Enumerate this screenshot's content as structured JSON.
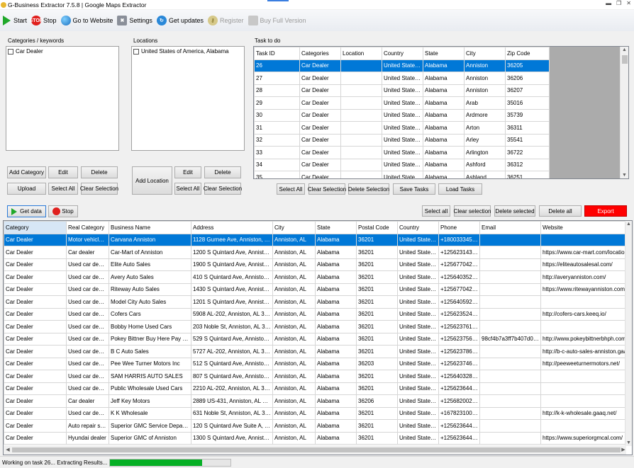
{
  "title": "G-Business Extractor 7.5.8 | Google Maps Extractor",
  "toolbar": {
    "start": "Start",
    "stop": "Stop",
    "website": "Go to Website",
    "settings": "Settings",
    "updates": "Get updates",
    "register": "Register",
    "buy": "Buy Full Version"
  },
  "categories": {
    "label": "Categories / keywords",
    "items": [
      "Car Dealer"
    ],
    "add": "Add Category",
    "edit": "Edit",
    "delete": "Delete",
    "upload": "Upload",
    "select_all": "Select All",
    "clear": "Clear Selection"
  },
  "locations": {
    "label": "Locations",
    "items": [
      "United States of America, Alabama"
    ],
    "add": "Add Location",
    "edit": "Edit",
    "delete": "Delete",
    "select_all": "Select All",
    "clear": "Clear Selection"
  },
  "tasks": {
    "label": "Task to do",
    "columns": [
      "Task ID",
      "Categories",
      "Location",
      "Country",
      "State",
      "City",
      "Zip Code"
    ],
    "rows": [
      [
        "26",
        "Car Dealer",
        "",
        "United States of ...",
        "Alabama",
        "Anniston",
        "36205"
      ],
      [
        "27",
        "Car Dealer",
        "",
        "United States of ...",
        "Alabama",
        "Anniston",
        "36206"
      ],
      [
        "28",
        "Car Dealer",
        "",
        "United States of ...",
        "Alabama",
        "Anniston",
        "36207"
      ],
      [
        "29",
        "Car Dealer",
        "",
        "United States of ...",
        "Alabama",
        "Arab",
        "35016"
      ],
      [
        "30",
        "Car Dealer",
        "",
        "United States of ...",
        "Alabama",
        "Ardmore",
        "35739"
      ],
      [
        "31",
        "Car Dealer",
        "",
        "United States of ...",
        "Alabama",
        "Arton",
        "36311"
      ],
      [
        "32",
        "Car Dealer",
        "",
        "United States of ...",
        "Alabama",
        "Arley",
        "35541"
      ],
      [
        "33",
        "Car Dealer",
        "",
        "United States of ...",
        "Alabama",
        "Arlington",
        "36722"
      ],
      [
        "34",
        "Car Dealer",
        "",
        "United States of ...",
        "Alabama",
        "Ashford",
        "36312"
      ],
      [
        "35",
        "Car Dealer",
        "",
        "United States of ...",
        "Alabama",
        "Ashland",
        "36251"
      ]
    ],
    "select_all": "Select All",
    "clear": "Clear Selection",
    "delete": "Delete Selection",
    "save": "Save Tasks",
    "load": "Load Tasks"
  },
  "actions": {
    "get_data": "Get data",
    "stop": "Stop",
    "select_all": "Select all",
    "clear": "Clear selection",
    "delete_selected": "Delete selected",
    "delete_all": "Delete all",
    "export": "Export"
  },
  "results": {
    "columns": [
      "Category",
      "Real Category",
      "Business Name",
      "Address",
      "City",
      "State",
      "Postal Code",
      "Country",
      "Phone",
      "Email",
      "Website"
    ],
    "rows": [
      [
        "Car Dealer",
        "Motor vehicle de...",
        "Carvana Anniston",
        "1128 Gurnee Ave, Anniston, AL 36201...",
        "Anniston, AL",
        "Alabama",
        "36201",
        "United States of ...",
        "+18003334554",
        "",
        ""
      ],
      [
        "Car Dealer",
        "Car dealer",
        "Car-Mart of Anniston",
        "1200 S Quintard Ave, Anniston, AL 36...",
        "Anniston, AL",
        "Alabama",
        "36201",
        "United States of ...",
        "+12562314336",
        "",
        "https://www.car-mart.com/locations/0..."
      ],
      [
        "Car Dealer",
        "Used car dealer",
        "Elite Auto Sales",
        "1900 S Quintard Ave, Anniston, AL 36...",
        "Anniston, AL",
        "Alabama",
        "36201",
        "United States of ...",
        "+12567704246",
        "",
        "https://eliteautosalesal.com/"
      ],
      [
        "Car Dealer",
        "Used car dealer",
        "Avery Auto Sales",
        "410 S Quintard Ave, Anniston, AL 362...",
        "Anniston, AL",
        "Alabama",
        "36201",
        "United States of ...",
        "+12564035200",
        "",
        "http://averyanniston.com/"
      ],
      [
        "Car Dealer",
        "Used car dealer",
        "Riteway Auto Sales",
        "1430 S Quintard Ave, Anniston, AL 36...",
        "Anniston, AL",
        "Alabama",
        "36201",
        "United States of ...",
        "+12567704211",
        "",
        "https://www.ritewayanniston.com/doc..."
      ],
      [
        "Car Dealer",
        "Used car dealer",
        "Model City Auto Sales",
        "1201 S Quintard Ave, Anniston, AL 36...",
        "Anniston, AL",
        "Alabama",
        "36201",
        "United States of ...",
        "+12564059265",
        "",
        ""
      ],
      [
        "Car Dealer",
        "Used car dealer",
        "Cofers Cars",
        "5908 AL-202, Anniston, AL 36201, Uni...",
        "Anniston, AL",
        "Alabama",
        "36201",
        "United States of ...",
        "+12562352456",
        "",
        "http://cofers-cars.keeq.io/"
      ],
      [
        "Car Dealer",
        "Used car dealer",
        "Bobby Home Used Cars",
        "203 Noble St, Anniston, AL 36201, Uni...",
        "Anniston, AL",
        "Alabama",
        "36201",
        "United States of ...",
        "+12562376183",
        "",
        ""
      ],
      [
        "Car Dealer",
        "Used car dealer",
        "Pokey Bittner Buy Here Pay Here",
        "529 S Quintard Ave, Anniston, AL 362...",
        "Anniston, AL",
        "Alabama",
        "36201",
        "United States of ...",
        "+12562375666",
        "98cf4b7a3ff7b407d094cd3...",
        "http://www.pokeybittnerbhph.com/"
      ],
      [
        "Car Dealer",
        "Used car dealer",
        "B C Auto Sales",
        "5727 AL-202, Anniston, AL 36201, Uni...",
        "Anniston, AL",
        "Alabama",
        "36201",
        "United States of ...",
        "+12562378699",
        "",
        "http://b-c-auto-sales-anniston.gaaq.net/"
      ],
      [
        "Car Dealer",
        "Used car dealer",
        "Pee Wee Turner Motors Inc",
        "512 S Quintard Ave, Anniston, AL 362...",
        "Anniston, AL",
        "Alabama",
        "36203",
        "United States of ...",
        "+12562374649",
        "",
        "http://peeweeturnermotors.net/"
      ],
      [
        "Car Dealer",
        "Used car dealer",
        "SAM HARRIS AUTO SALES",
        "807 S Quintard Ave, Anniston, AL 362...",
        "Anniston, AL",
        "Alabama",
        "36201",
        "United States of ...",
        "+12564032811",
        "",
        ""
      ],
      [
        "Car Dealer",
        "Used car dealer",
        "Public Wholesale Used Cars",
        "2210 AL-202, Anniston, AL 36201, Uni...",
        "Anniston, AL",
        "Alabama",
        "36201",
        "United States of ...",
        "+12562364468",
        "",
        ""
      ],
      [
        "Car Dealer",
        "Car dealer",
        "Jeff Key Motors",
        "2889 US-431, Anniston, AL 36206, Un...",
        "Anniston, AL",
        "Alabama",
        "36206",
        "United States of ...",
        "+12568200280",
        "",
        ""
      ],
      [
        "Car Dealer",
        "Used car dealer",
        "K K Wholesale",
        "631 Noble St, Anniston, AL 36201, Uni...",
        "Anniston, AL",
        "Alabama",
        "36201",
        "United States of ...",
        "+16782310020",
        "",
        "http://k-k-wholesale.gaaq.net/"
      ],
      [
        "Car Dealer",
        "Auto repair shop",
        "Superior GMC Service Department",
        "120 S Quintard Ave Suite A, Anniston, ...",
        "Anniston, AL",
        "Alabama",
        "36201",
        "United States of ...",
        "+12562364444",
        "",
        ""
      ],
      [
        "Car Dealer",
        "Hyundai dealer",
        "Superior GMC of Anniston",
        "1300 S Quintard Ave, Anniston, AL 36...",
        "Anniston, AL",
        "Alabama",
        "36201",
        "United States of ...",
        "+12562364444",
        "",
        "https://www.superiorgmcal.com/"
      ]
    ]
  },
  "status": {
    "text": "Working on task 26... Extracting Results...",
    "progress": 0.76
  },
  "colors": {
    "selection": "#0078d7",
    "export": "#ff0000",
    "progress": "#06b025"
  }
}
